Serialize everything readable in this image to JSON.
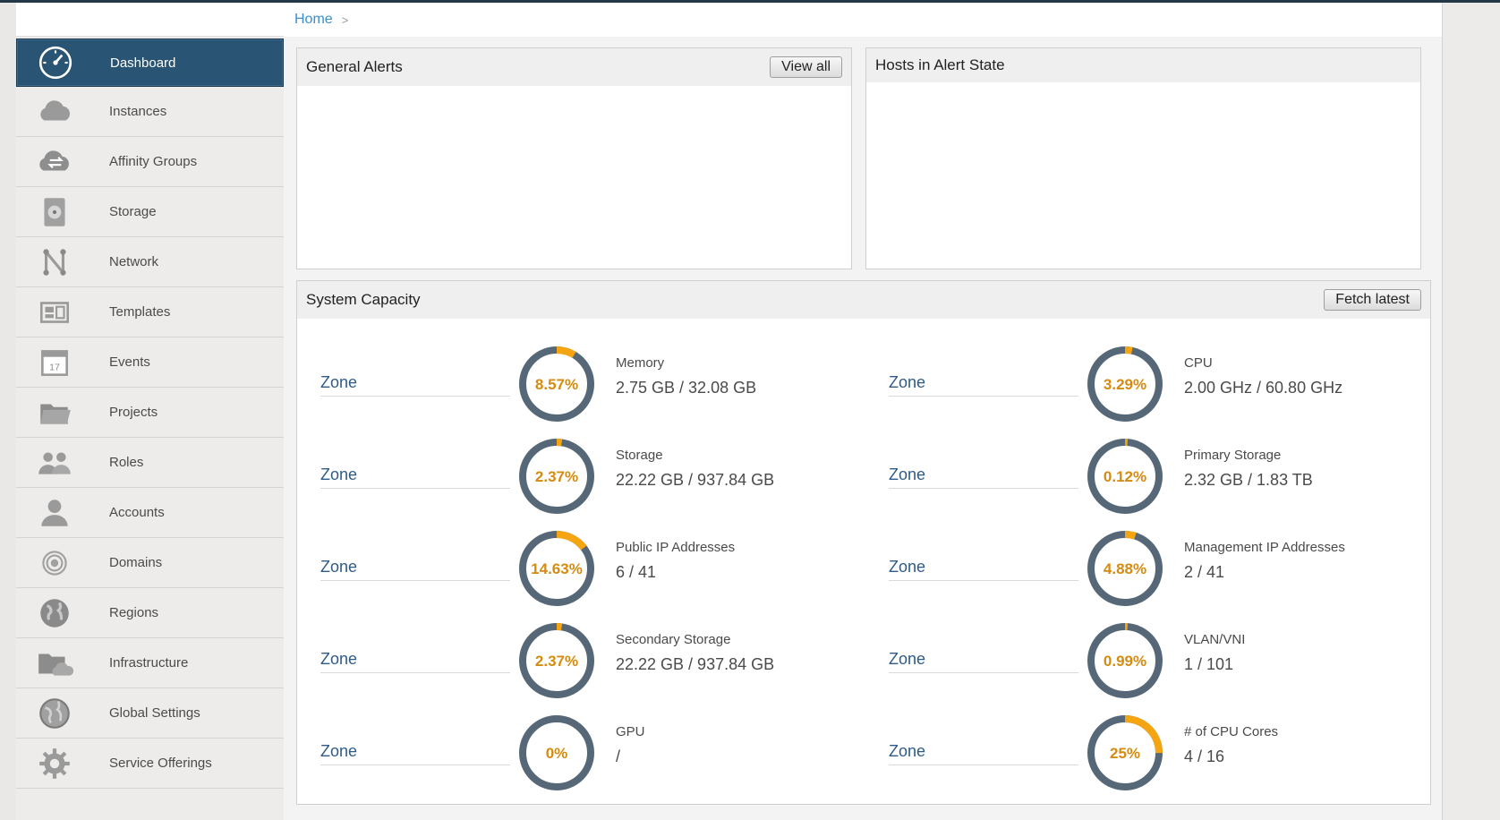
{
  "breadcrumb": {
    "home": "Home",
    "separator": ">"
  },
  "sidebar": {
    "items": [
      {
        "label": "Dashboard",
        "icon": "dashboard-icon",
        "active": true
      },
      {
        "label": "Instances",
        "icon": "cloud-icon"
      },
      {
        "label": "Affinity Groups",
        "icon": "cloud-arrows-icon"
      },
      {
        "label": "Storage",
        "icon": "hard-disk-icon"
      },
      {
        "label": "Network",
        "icon": "network-icon"
      },
      {
        "label": "Templates",
        "icon": "templates-icon"
      },
      {
        "label": "Events",
        "icon": "calendar-icon",
        "badge": "17"
      },
      {
        "label": "Projects",
        "icon": "folder-icon"
      },
      {
        "label": "Roles",
        "icon": "people-icon"
      },
      {
        "label": "Accounts",
        "icon": "user-icon"
      },
      {
        "label": "Domains",
        "icon": "target-icon"
      },
      {
        "label": "Regions",
        "icon": "globe-icon"
      },
      {
        "label": "Infrastructure",
        "icon": "folder-cloud-icon"
      },
      {
        "label": "Global Settings",
        "icon": "globe-gear-icon"
      },
      {
        "label": "Service Offerings",
        "icon": "gear-icon"
      }
    ]
  },
  "general_alerts": {
    "title": "General Alerts",
    "view_all": "View all"
  },
  "hosts_alert": {
    "title": "Hosts in Alert State"
  },
  "capacity": {
    "title": "System Capacity",
    "fetch_latest": "Fetch latest",
    "items": [
      {
        "zone": "Zone",
        "name": "Memory",
        "value": "2.75 GB / 32.08 GB",
        "percent_label": "8.57%",
        "fraction": 0.0857
      },
      {
        "zone": "Zone",
        "name": "CPU",
        "value": "2.00 GHz / 60.80 GHz",
        "percent_label": "3.29%",
        "fraction": 0.0329
      },
      {
        "zone": "Zone",
        "name": "Storage",
        "value": "22.22 GB / 937.84 GB",
        "percent_label": "2.37%",
        "fraction": 0.0237
      },
      {
        "zone": "Zone",
        "name": "Primary Storage",
        "value": "2.32 GB / 1.83 TB",
        "percent_label": "0.12%",
        "fraction": 0.0012
      },
      {
        "zone": "Zone",
        "name": "Public IP Addresses",
        "value": "6 / 41",
        "percent_label": "14.63%",
        "fraction": 0.1463
      },
      {
        "zone": "Zone",
        "name": "Management IP Addresses",
        "value": "2 / 41",
        "percent_label": "4.88%",
        "fraction": 0.0488
      },
      {
        "zone": "Zone",
        "name": "Secondary Storage",
        "value": "22.22 GB / 937.84 GB",
        "percent_label": "2.37%",
        "fraction": 0.0237
      },
      {
        "zone": "Zone",
        "name": "VLAN/VNI",
        "value": "1 / 101",
        "percent_label": "0.99%",
        "fraction": 0.0099
      },
      {
        "zone": "Zone",
        "name": "GPU",
        "value": "/",
        "percent_label": "0%",
        "fraction": 0
      },
      {
        "zone": "Zone",
        "name": "# of CPU Cores",
        "value": "4 / 16",
        "percent_label": "25%",
        "fraction": 0.25
      }
    ]
  },
  "colors": {
    "accent": "#f5a511",
    "ring": "#566878",
    "active_nav": "#2a5473",
    "link": "#2e5b88"
  }
}
